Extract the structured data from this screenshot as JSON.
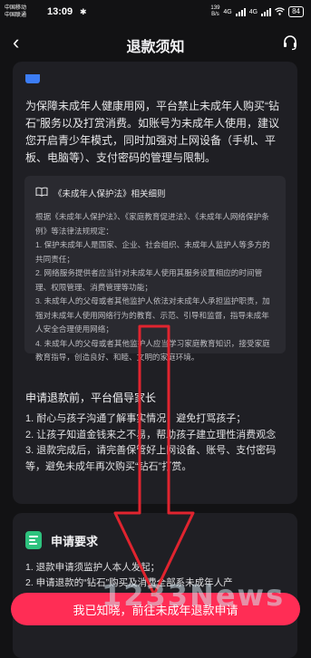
{
  "status_bar": {
    "carrier1": "中国移动",
    "carrier2": "中国联通",
    "time": "13:09",
    "bluetooth": "✱",
    "data_rate": "139",
    "data_unit": "B/s",
    "network1": "4G",
    "network2": "4G",
    "battery": "84"
  },
  "nav": {
    "back": "‹",
    "title": "退款须知",
    "headset_icon": "headset-icon"
  },
  "intro_text": "为保障未成年人健康用网，平台禁止未成年人购买“钻石”服务以及打赏消费。如账号为未成年人使用，建议您开启青少年模式，同时加强对上网设备（手机、平板、电脑等）、支付密码的管理与限制。",
  "law_box": {
    "title": "《未成年人保护法》相关细则",
    "paragraphs": [
      "根据《未成年人保护法》、《家庭教育促进法》、《未成年人网络保护条例》等法律法规规定：",
      "1. 保护未成年人是国家、企业、社会组织、未成年人监护人等多方的共同责任；",
      "2. 网络服务提供者应当针对未成年人使用其服务设置相应的时间管理、权限管理、消费管理等功能；",
      "3. 未成年人的父母或者其他监护人依法对未成年人承担监护职责，加强对未成年人使用网络行为的教育、示范、引导和监督，指导未成年人安全合理使用网络；",
      "4. 未成年人的父母或者其他监护人应当学习家庭教育知识，接受家庭教育指导，创造良好、和睦、文明的家庭环境。"
    ]
  },
  "parent_section": {
    "title": "申请退款前，平台倡导家长",
    "items": [
      "1. 耐心与孩子沟通了解事实情况，避免打骂孩子；",
      "2. 让孩子知道金钱来之不易，帮助孩子建立理性消费观念",
      "3. 退款完成后，请完善保管好上网设备、账号、支付密码等，避免未成年再次购买“钻石”打赏。"
    ]
  },
  "requirements": {
    "title": "申请要求",
    "items": [
      "1. 退款申请须监护人本人发起；",
      "2. 申请退款的“钻石”购买及消费全部系未成年人产"
    ]
  },
  "cta_label": "我已知晓，前往未成年退款申请",
  "watermark": "1233News",
  "colors": {
    "background": "#121214",
    "card": "#1f1f24",
    "inner_box": "#2a2a30",
    "accent_button": "#ff2d55",
    "arrow_outline": "#e0242f",
    "doc_icon": "#2ec27e"
  }
}
